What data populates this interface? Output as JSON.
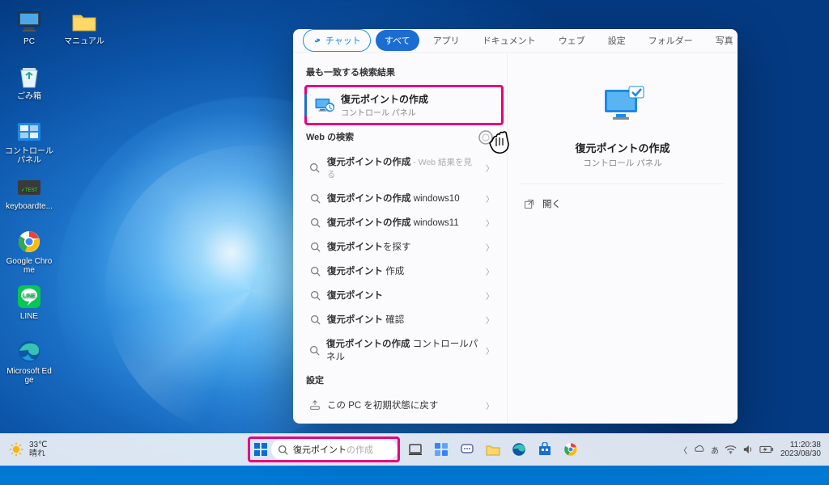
{
  "desktop": {
    "icons": [
      {
        "label": "PC",
        "kind": "pc"
      },
      {
        "label": "マニュアル",
        "kind": "folder"
      },
      {
        "label": "ごみ箱",
        "kind": "recycle"
      },
      {
        "label": "コントロール パネル",
        "kind": "cpanel"
      },
      {
        "label": "keyboardte...",
        "kind": "keytest"
      },
      {
        "label": "Google Chrome",
        "kind": "chrome"
      },
      {
        "label": "LINE",
        "kind": "line"
      },
      {
        "label": "Microsoft Edge",
        "kind": "edge"
      }
    ]
  },
  "search": {
    "tabs": {
      "chat": "チャット",
      "all": "すべて",
      "apps": "アプリ",
      "docs": "ドキュメント",
      "web": "ウェブ",
      "settings": "設定",
      "folders": "フォルダー",
      "photos": "写真"
    },
    "best_match_header": "最も一致する検索結果",
    "best_match": {
      "title_bold": "復元ポイント",
      "title_rest": "の作成",
      "subtitle": "コントロール パネル"
    },
    "web_header": "Web の検索",
    "web_results": [
      {
        "bold": "復元ポイントの作成",
        "rest": "",
        "hint": " - Web 結果を見る"
      },
      {
        "bold": "復元ポイントの作成",
        "rest": " windows10",
        "hint": ""
      },
      {
        "bold": "復元ポイントの作成",
        "rest": " windows11",
        "hint": ""
      },
      {
        "bold": "復元ポイント",
        "rest": "を探す",
        "hint": ""
      },
      {
        "bold": "復元ポイント",
        "rest": " 作成",
        "hint": ""
      },
      {
        "bold": "復元ポイント",
        "rest": "",
        "hint": ""
      },
      {
        "bold": "復元ポイント",
        "rest": " 確認",
        "hint": ""
      },
      {
        "bold": "復元ポイントの作成",
        "rest": " コントロールパネル",
        "hint": ""
      }
    ],
    "settings_header": "設定",
    "settings_item": "この PC を初期状態に戻す",
    "detail": {
      "title": "復元ポイントの作成",
      "subtitle": "コントロール パネル",
      "open": "開く"
    }
  },
  "taskbar": {
    "weather_temp": "33℃",
    "weather_desc": "晴れ",
    "search_typed": "復元ポイント",
    "search_ghost": "の作成",
    "ime": "あ",
    "time": "11:20:38",
    "date": "2023/08/30"
  }
}
